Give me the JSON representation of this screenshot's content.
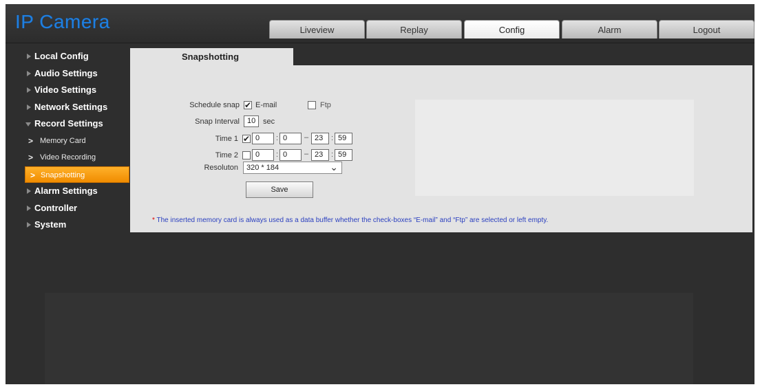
{
  "app": {
    "title": "IP Camera"
  },
  "tabs": [
    {
      "label": "Liveview",
      "active": false
    },
    {
      "label": "Replay",
      "active": false
    },
    {
      "label": "Config",
      "active": true
    },
    {
      "label": "Alarm",
      "active": false
    },
    {
      "label": "Logout",
      "active": false
    }
  ],
  "sidebar": {
    "items": [
      {
        "label": "Local Config"
      },
      {
        "label": "Audio Settings"
      },
      {
        "label": "Video Settings"
      },
      {
        "label": "Network Settings"
      },
      {
        "label": "Record Settings",
        "expanded": true
      },
      {
        "label": "Memory Card",
        "sub": true
      },
      {
        "label": "Video Recording",
        "sub": true
      },
      {
        "label": "Snapshotting",
        "sub": true,
        "active": true
      },
      {
        "label": "Alarm Settings"
      },
      {
        "label": "Controller"
      },
      {
        "label": "System"
      }
    ]
  },
  "content": {
    "tab_title": "Snapshotting",
    "schedule_snap": {
      "label": "Schedule snap",
      "email_label": "E-mail",
      "email_checked": true,
      "ftp_label": "Ftp",
      "ftp_checked": false
    },
    "snap_interval": {
      "label": "Snap Interval",
      "value": "10",
      "unit": "sec"
    },
    "time1": {
      "label": "Time 1",
      "checked": true,
      "start_h": "0",
      "start_m": "0",
      "end_h": "23",
      "end_m": "59"
    },
    "time2": {
      "label": "Time 2",
      "checked": false,
      "start_h": "0",
      "start_m": "0",
      "end_h": "23",
      "end_m": "59"
    },
    "resolution": {
      "label": "Resoluton",
      "value": "320 * 184"
    },
    "save_label": "Save",
    "note": "The inserted memory card is always used as a data buffer whether the check-boxes “E-mail” and “Ftp” are selected or left empty.",
    "note_marker": "*"
  },
  "colors": {
    "logo": "#1f7fe0",
    "active_menu": "#f59a0c",
    "note": "#2a3fbf",
    "background": "#2e2e2e"
  },
  "icons": {
    "checked": "✔",
    "dropdown": "chevron-down-icon"
  }
}
